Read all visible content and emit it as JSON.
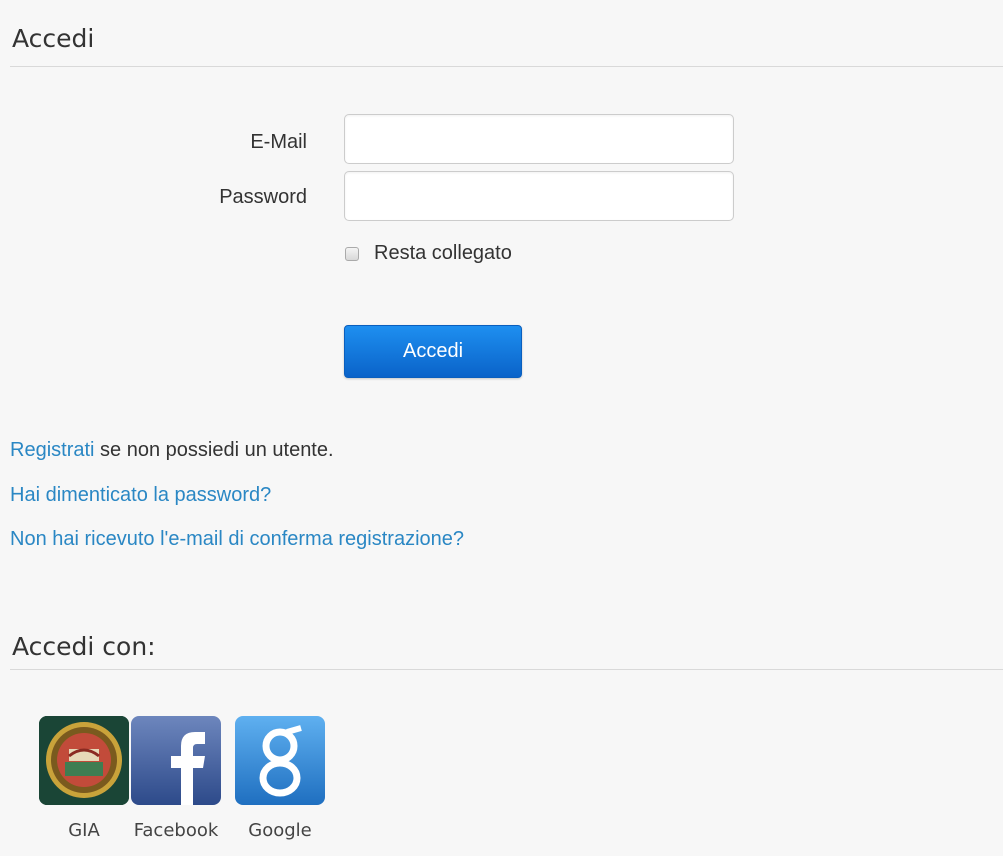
{
  "login": {
    "title": "Accedi",
    "email_label": "E-Mail",
    "email_value": "",
    "password_label": "Password",
    "password_value": "",
    "remember_label": "Resta collegato",
    "submit_label": "Accedi"
  },
  "links": {
    "register_link": "Registrati",
    "register_suffix": " se non possiedi un utente.",
    "forgot_password": "Hai dimenticato la password?",
    "resend_confirmation": "Non hai ricevuto l'e-mail di conferma registrazione?"
  },
  "social": {
    "title": "Accedi con:",
    "providers": [
      {
        "label": "GIA",
        "icon": "gia-logo-icon",
        "color": "#1d4a3a"
      },
      {
        "label": "Facebook",
        "icon": "facebook-icon",
        "color": "#3b5998"
      },
      {
        "label": "Google",
        "icon": "google-icon",
        "color": "#2f87d6"
      }
    ]
  },
  "colors": {
    "accent": "#1a7fe0",
    "link": "#2a87c4",
    "background": "#f7f7f7"
  }
}
